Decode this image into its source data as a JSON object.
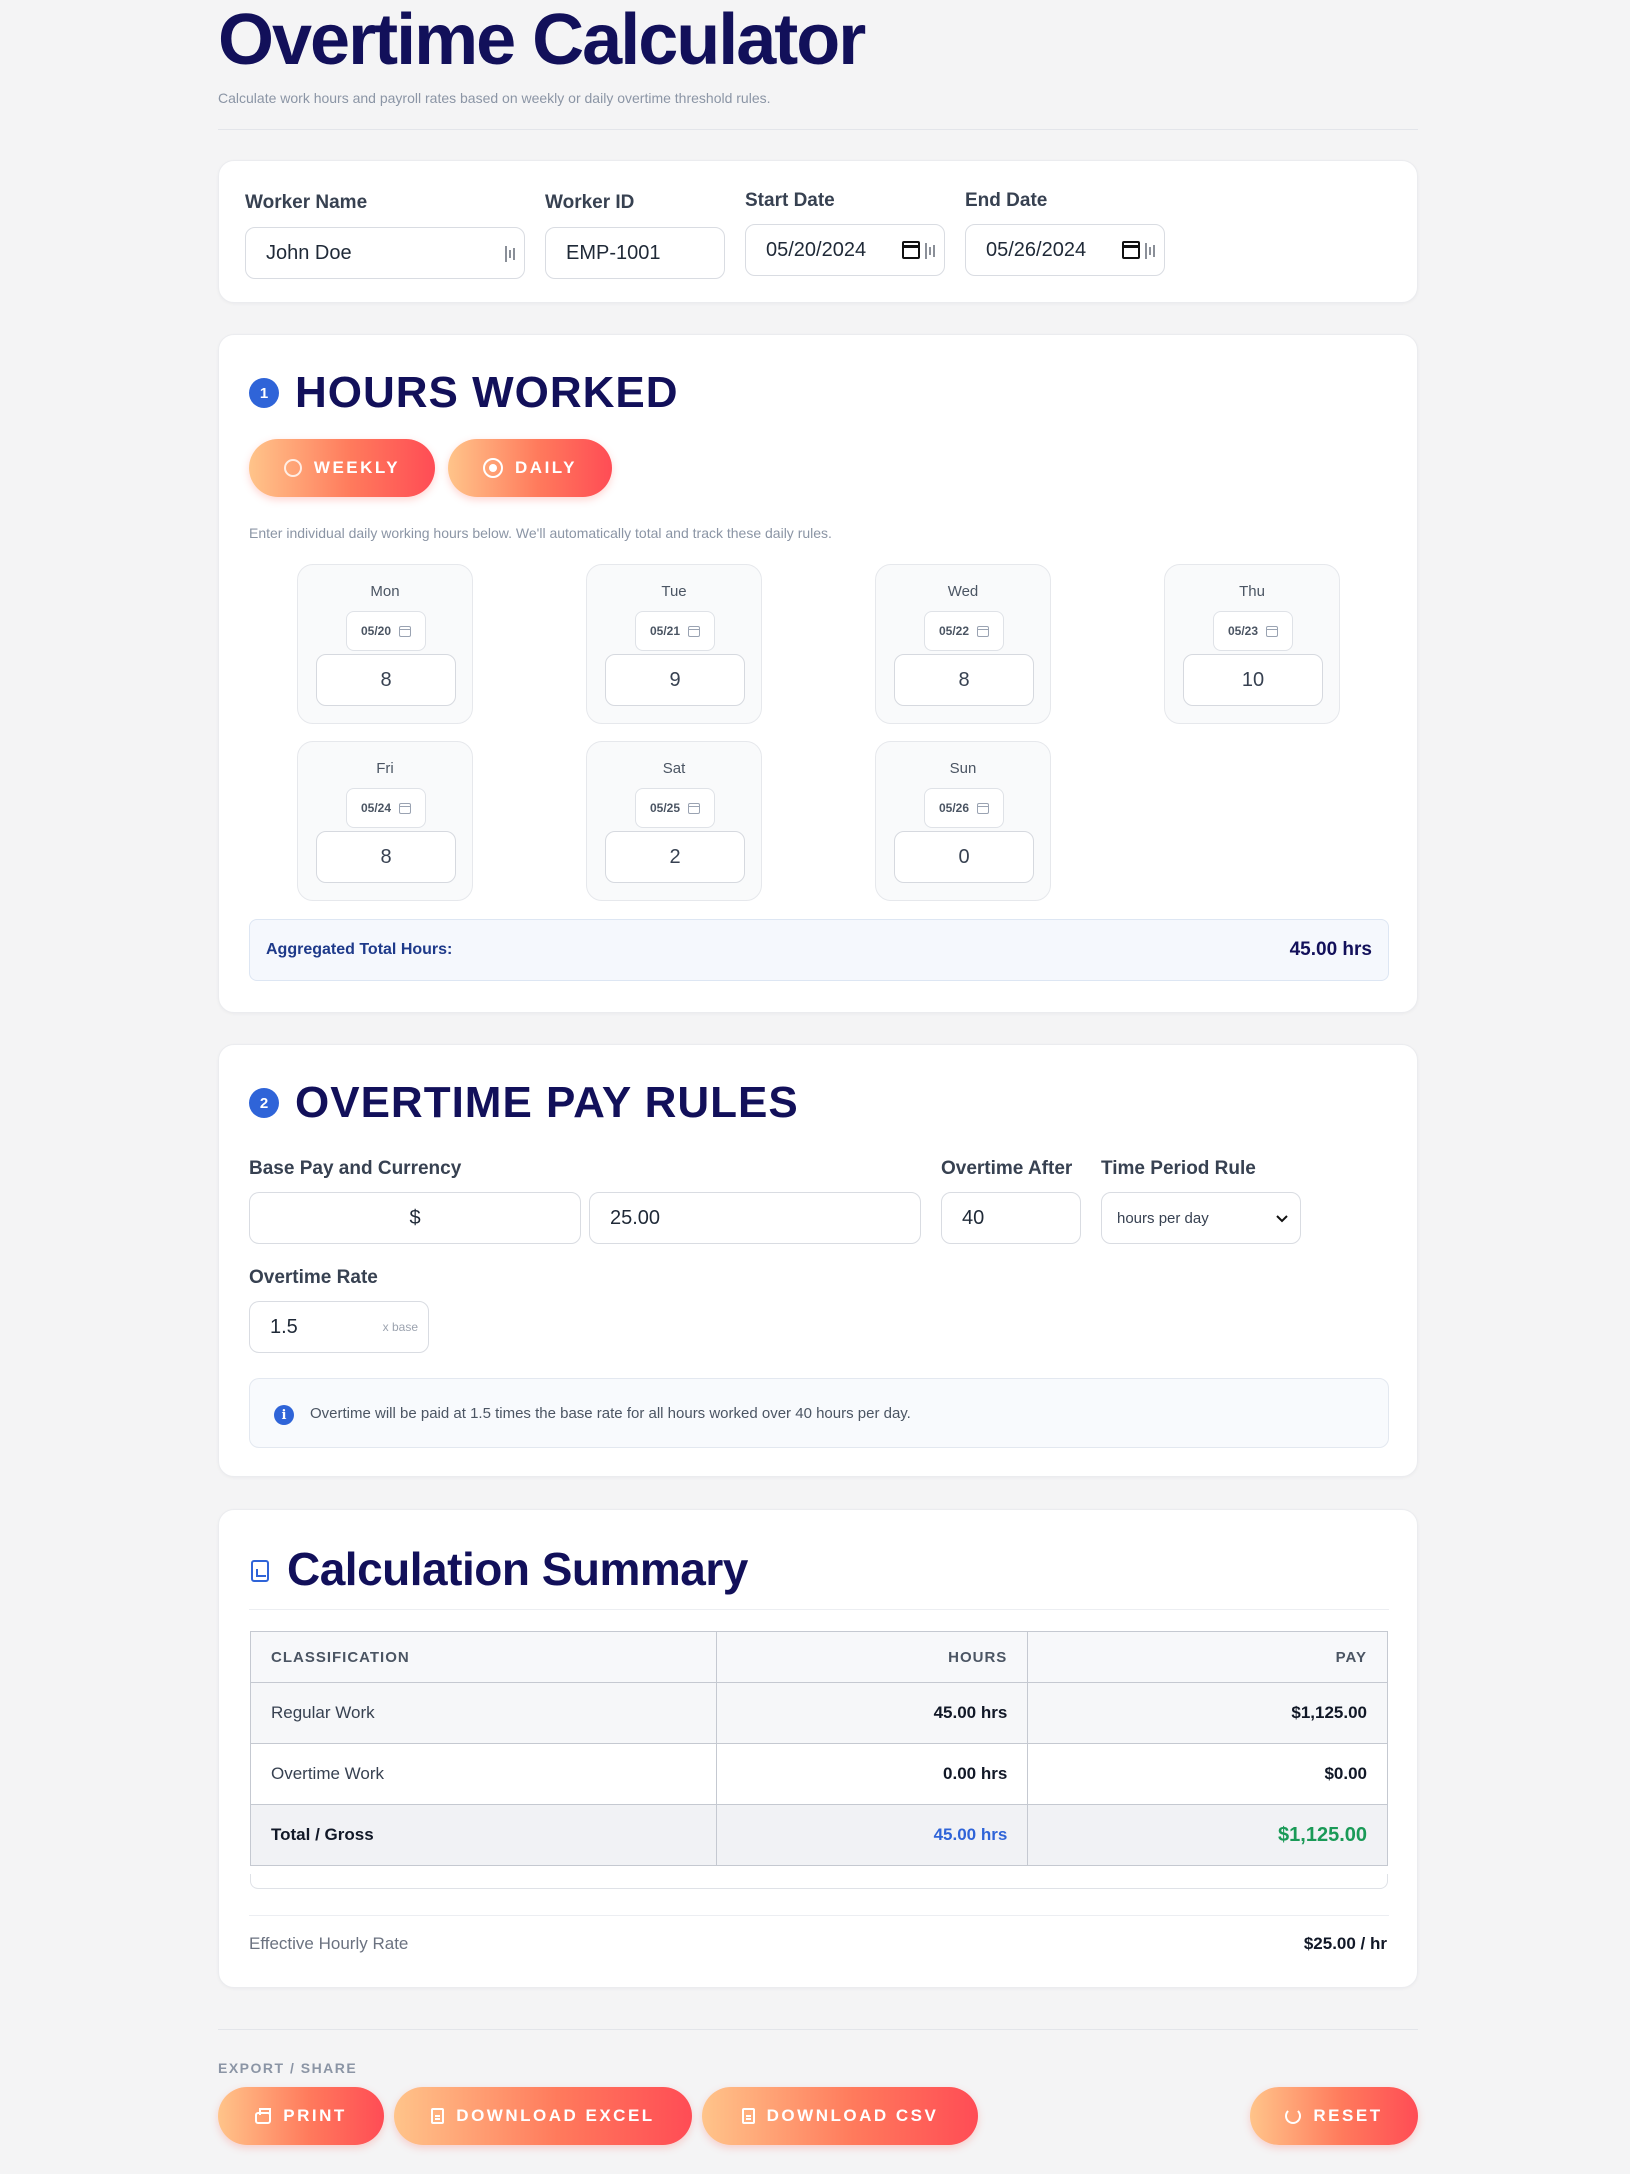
{
  "header": {
    "title": "Overtime Calculator",
    "subtitle": "Calculate work hours and payroll rates based on weekly or daily overtime threshold rules."
  },
  "worker": {
    "name_label": "Worker Name",
    "name_value": "John Doe",
    "id_label": "Worker ID",
    "id_value": "EMP-1001",
    "start_label": "Start Date",
    "start_value": "05/20/2024",
    "end_label": "End Date",
    "end_value": "05/26/2024"
  },
  "hours": {
    "step": "1",
    "title": "HOURS WORKED",
    "mode_weekly": "WEEKLY",
    "mode_daily": "DAILY",
    "selected_mode": "DAILY",
    "hint": "Enter individual daily working hours below. We'll automatically total and track these daily rules.",
    "days": [
      {
        "name": "Mon",
        "date": "05/20",
        "hours": "8"
      },
      {
        "name": "Tue",
        "date": "05/21",
        "hours": "9"
      },
      {
        "name": "Wed",
        "date": "05/22",
        "hours": "8"
      },
      {
        "name": "Thu",
        "date": "05/23",
        "hours": "10"
      },
      {
        "name": "Fri",
        "date": "05/24",
        "hours": "8"
      },
      {
        "name": "Sat",
        "date": "05/25",
        "hours": "2"
      },
      {
        "name": "Sun",
        "date": "05/26",
        "hours": "0"
      }
    ],
    "total_label": "Aggregated Total Hours:",
    "total_value": "45.00 hrs"
  },
  "rules": {
    "step": "2",
    "title": "OVERTIME PAY RULES",
    "base_label": "Base Pay and Currency",
    "currency": "$",
    "base_rate": "25.00",
    "after_label": "Overtime After",
    "after_value": "40",
    "period_label": "Time Period Rule",
    "period_value": "hours per day",
    "rate_label": "Overtime Rate",
    "rate_value": "1.5",
    "rate_suffix": "x base",
    "info_icon": "i",
    "info_text": "Overtime will be paid at 1.5 times the base rate for all hours worked over 40 hours per day."
  },
  "summary": {
    "title": "Calculation Summary",
    "columns": [
      "CLASSIFICATION",
      "HOURS",
      "PAY"
    ],
    "rows": [
      {
        "label": "Regular Work",
        "hours": "45.00 hrs",
        "pay": "$1,125.00"
      },
      {
        "label": "Overtime Work",
        "hours": "0.00 hrs",
        "pay": "$0.00"
      }
    ],
    "total": {
      "label": "Total / Gross",
      "hours": "45.00 hrs",
      "pay": "$1,125.00"
    },
    "effective_label": "Effective Hourly Rate",
    "effective_value": "$25.00 / hr"
  },
  "footer": {
    "export_label": "EXPORT / SHARE",
    "print": "PRINT",
    "excel": "DOWNLOAD EXCEL",
    "csv": "DOWNLOAD CSV",
    "reset": "RESET"
  },
  "colors": {
    "navy": "#12105a",
    "accent_blue": "#2f64d8",
    "button_gradient_start": "#ffc48a",
    "button_gradient_end": "#ff4c55",
    "total_pay_green": "#1a9a57",
    "total_hours_blue": "#2f64d8"
  }
}
